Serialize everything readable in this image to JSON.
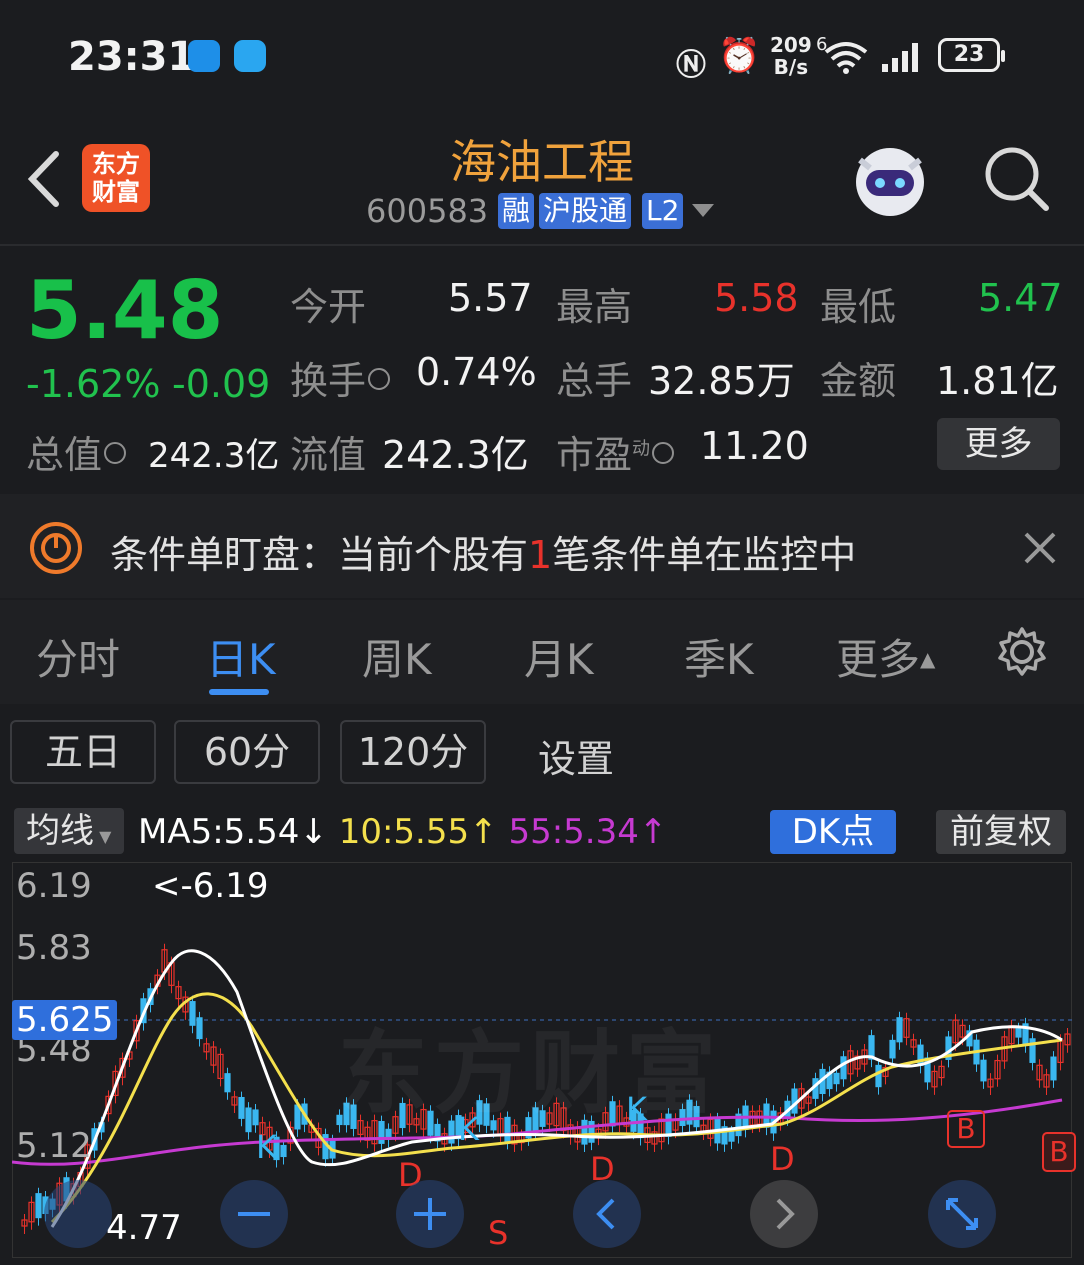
{
  "status_bar": {
    "time": "23:31",
    "net_speed_top": "209",
    "net_speed_bottom": "B/s",
    "wifi_num": "6",
    "battery": "23"
  },
  "header": {
    "logo_line1": "东方",
    "logo_line2": "财富",
    "stock_name": "海油工程",
    "stock_code": "600583",
    "tags": [
      "融",
      "沪股通",
      "L2"
    ]
  },
  "quote": {
    "price": "5.48",
    "change_pct": "-1.62%",
    "change_val": "-0.09",
    "open_label": "今开",
    "open_value": "5.57",
    "high_label": "最高",
    "high_value": "5.58",
    "low_label": "最低",
    "low_value": "5.47",
    "turnover_label": "换手",
    "turnover_value": "0.74%",
    "volume_label": "总手",
    "volume_value": "32.85万",
    "amount_label": "金额",
    "amount_value": "1.81亿",
    "mktcap_label": "总值",
    "mktcap_value": "242.3亿",
    "float_label": "流值",
    "float_value": "242.3亿",
    "pe_label": "市盈",
    "pe_sup": "动",
    "pe_value": "11.20",
    "more_label": "更多"
  },
  "banner": {
    "prefix": "条件单盯盘：当前个股有",
    "count": "1",
    "suffix": "笔条件单在监控中"
  },
  "tabs": [
    "分时",
    "日K",
    "周K",
    "月K",
    "季K",
    "更多"
  ],
  "active_tab": "日K",
  "period_buttons": [
    "五日",
    "60分",
    "120分",
    "设置"
  ],
  "ma_bar": {
    "select": "均线",
    "ma5": "MA5:5.54",
    "ma5_arrow": "↓",
    "ma10": "10:5.55",
    "ma10_arrow": "↑",
    "ma55": "55:5.34",
    "ma55_arrow": "↑",
    "dk": "DK点",
    "fq": "前复权"
  },
  "chart": {
    "y_ticks": [
      "6.19",
      "5.83",
      "5.48",
      "5.12"
    ],
    "current_price_tag": "5.625",
    "max_label": "<-6.19",
    "min_label": "4.77",
    "watermark": "东方财富",
    "signals": [
      "K",
      "D",
      "K",
      "D",
      "K",
      "D",
      "B",
      "B",
      "S"
    ]
  },
  "colors": {
    "up": "#e8322b",
    "down": "#21c24e",
    "accent": "#3d8ef2",
    "ma5": "#ffffff",
    "ma10": "#f4e04d",
    "ma55": "#c63ad1",
    "brand": "#ef5227"
  }
}
